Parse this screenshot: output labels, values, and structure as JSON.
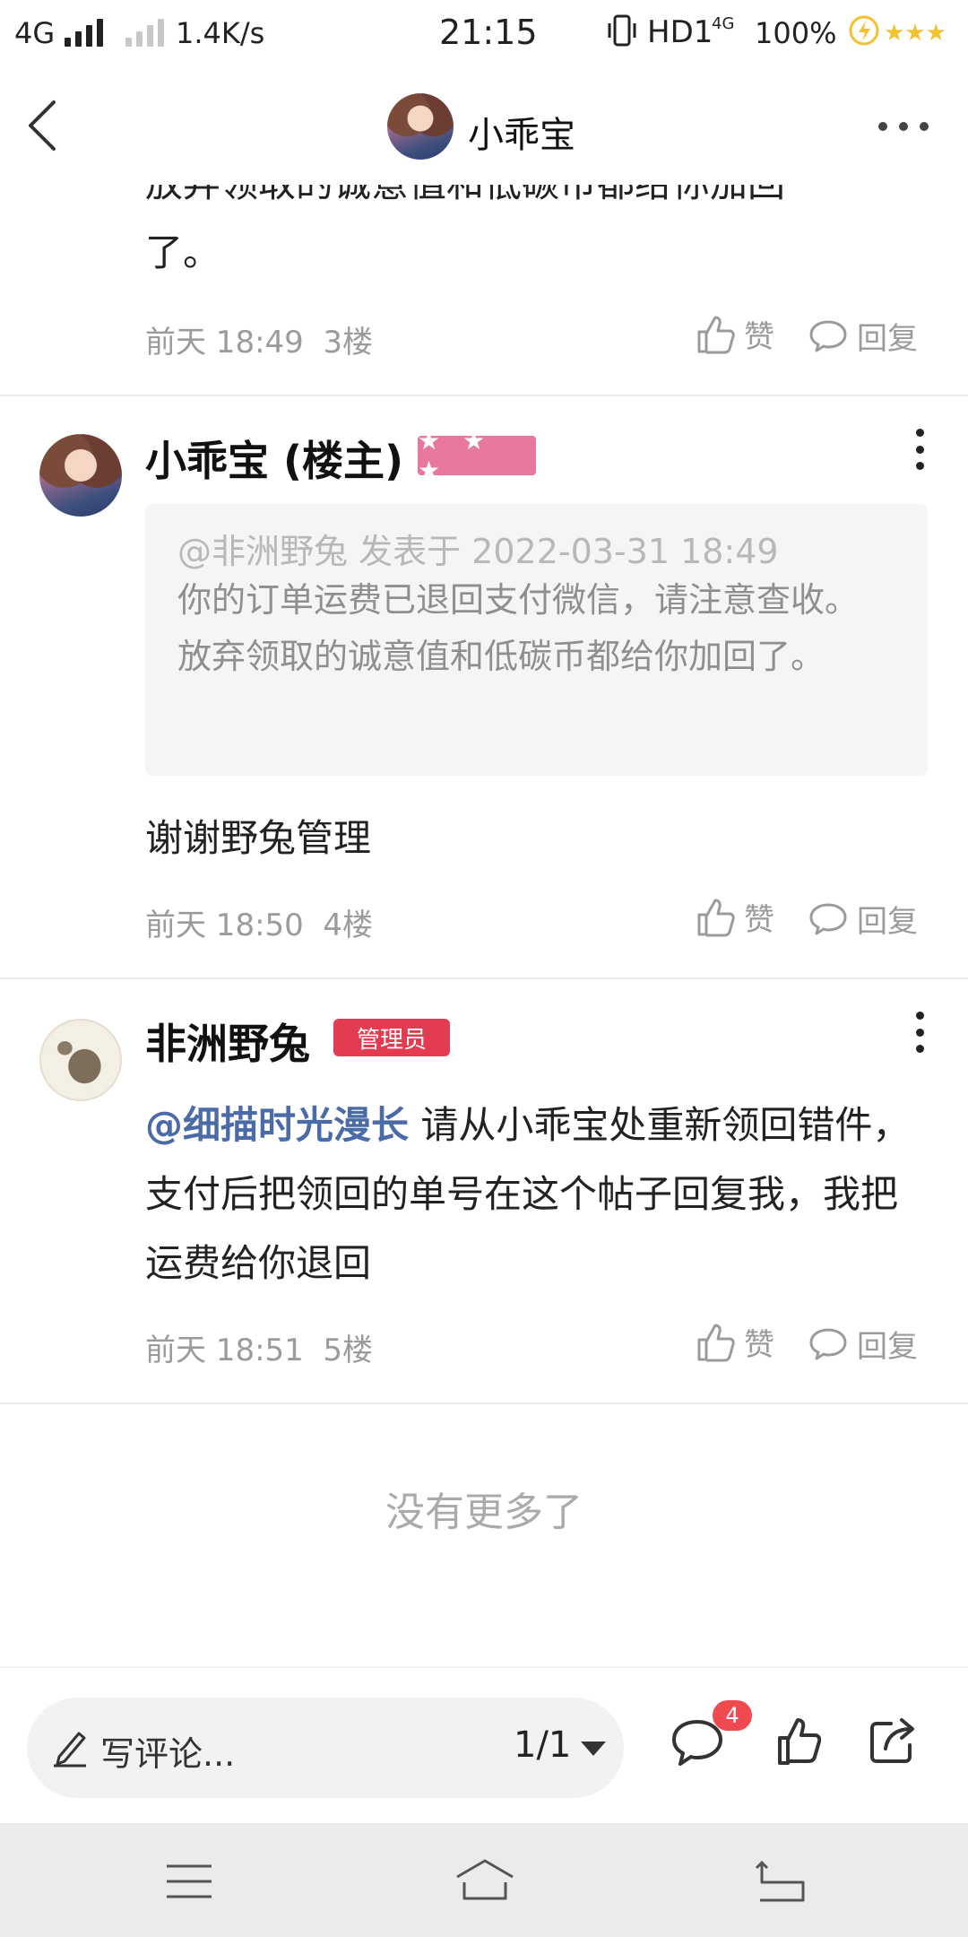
{
  "status_bar": {
    "network": "4G",
    "speed": "1.4K/s",
    "time": "21:15",
    "hd": "HD1",
    "network2": "4G",
    "battery": "100%",
    "stars": "★★★"
  },
  "header": {
    "title": "小乖宝"
  },
  "posts": [
    {
      "partial_text": "放弃领取的诚意值和低碳币都给你加回",
      "partial_text_line2": "了。",
      "time": "前天 18:49",
      "floor": "3楼",
      "like_label": "赞",
      "reply_label": "回复"
    },
    {
      "name": "小乖宝 (楼主)",
      "badge": "★ ★ ★",
      "quote_head": "@非洲野兔 发表于 2022-03-31 18:49",
      "quote_body": "你的订单运费已退回支付微信，请注意查收。放弃领取的诚意值和低碳币都给你加回了。",
      "text": "谢谢野兔管理",
      "time": "前天 18:50",
      "floor": "4楼",
      "like_label": "赞",
      "reply_label": "回复"
    },
    {
      "name": "非洲野兔",
      "badge": "管理员",
      "mention": "@细描时光漫长",
      "text": " 请从小乖宝处重新领回错件，支付后把领回的单号在这个帖子回复我，我把运费给你退回",
      "time": "前天 18:51",
      "floor": "5楼",
      "like_label": "赞",
      "reply_label": "回复"
    }
  ],
  "no_more": "没有更多了",
  "bottom_bar": {
    "placeholder": "写评论...",
    "page": "1/1",
    "comment_count": "4"
  },
  "colors": {
    "accent_pink": "#e8799c",
    "admin_red": "#e33b4f",
    "mention_blue": "#4a6aa8",
    "badge_red": "#f0494f"
  }
}
